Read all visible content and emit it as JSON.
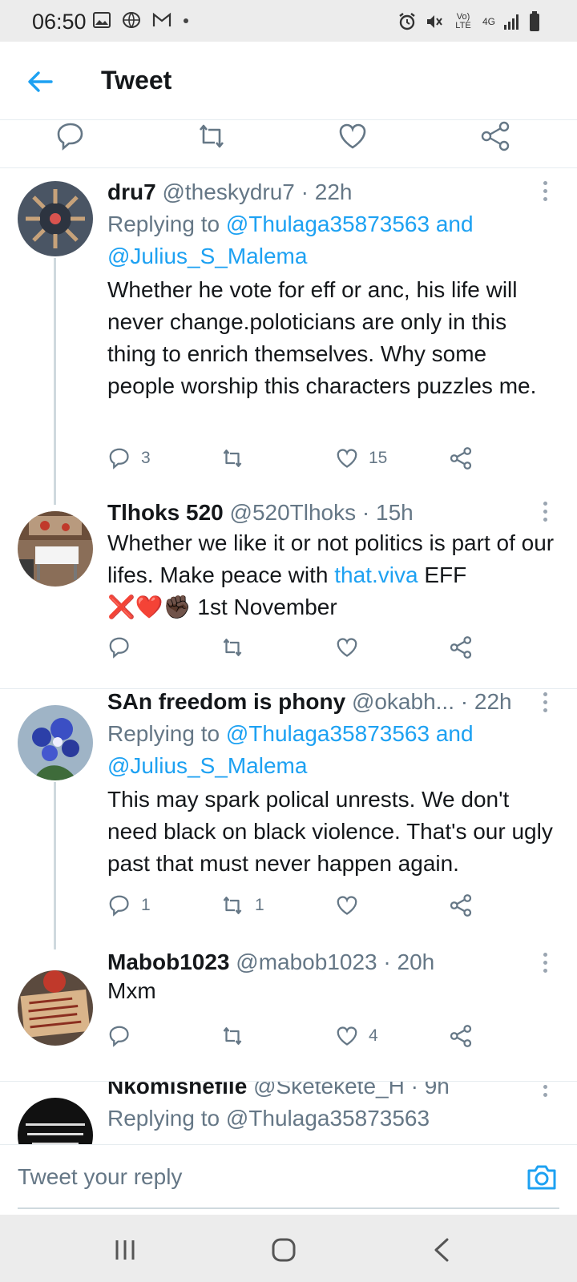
{
  "status_bar": {
    "time": "06:50",
    "left_icons": [
      "image-icon",
      "globe-icon",
      "gmail-icon",
      "dot-icon"
    ],
    "right_icons": [
      "alarm-icon",
      "mute-icon",
      "volte-icon",
      "4g-icon",
      "signal-icon",
      "battery-icon"
    ],
    "volte_label": "Vo) LTE",
    "network_label": "4G"
  },
  "header": {
    "title": "Tweet"
  },
  "colors": {
    "accent": "#1da1f2",
    "text": "#14171a",
    "muted": "#657786",
    "divider": "#e6ecf0"
  },
  "tweets": [
    {
      "name": "dru7",
      "handle": "@theskydru7",
      "time": "· 22h",
      "reply_prefix": "Replying to",
      "reply_user1": "@Thulaga35873563",
      "reply_and": "and",
      "reply_user2": "@Julius_S_Malema",
      "text": "Whether he vote for eff or anc, his life will never change.poloticians are only in this thing to enrich themselves. Why some people worship this characters puzzles me.",
      "replies": "3",
      "retweets": "",
      "likes": "15"
    },
    {
      "name": "Tlhoks 520",
      "handle": "@520Tlhoks",
      "time": "· 15h",
      "text_part1": "Whether we like it or not politics is part of our lifes. Make peace with",
      "link": "that.viva",
      "text_part2": "EFF",
      "emojis": "❌❤️✊🏿",
      "text_part3": "1st November",
      "replies": "",
      "retweets": "",
      "likes": ""
    },
    {
      "name": "SAn freedom is phony",
      "handle": "@okabh...",
      "time": "· 22h",
      "reply_prefix": "Replying to",
      "reply_user1": "@Thulaga35873563",
      "reply_and": "and",
      "reply_user2": "@Julius_S_Malema",
      "text": "This may spark polical unrests. We don't need black on black violence. That's our ugly past that must never happen again.",
      "replies": "1",
      "retweets": "1",
      "likes": ""
    },
    {
      "name": "Mabob1023",
      "handle": "@mabob1023",
      "time": "· 20h",
      "text": "Mxm",
      "replies": "",
      "retweets": "",
      "likes": "4"
    },
    {
      "name": "Nkomishefile",
      "handle": "@Sketekete_H",
      "time": "· 9h",
      "reply_partial": "Replying to @Thulaga35873563"
    }
  ],
  "reply_box": {
    "placeholder": "Tweet your reply"
  },
  "nav": [
    "recent-apps-icon",
    "home-icon",
    "back-icon"
  ]
}
